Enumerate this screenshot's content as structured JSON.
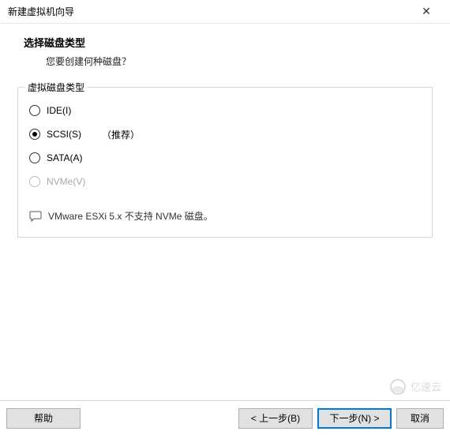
{
  "window": {
    "title": "新建虚拟机向导"
  },
  "header": {
    "heading": "选择磁盘类型",
    "subtitle": "您要创建何种磁盘？"
  },
  "fieldset": {
    "legend": "虚拟磁盘类型",
    "options": [
      {
        "label": "IDE(I)",
        "selected": false,
        "disabled": false,
        "recommended": ""
      },
      {
        "label": "SCSI(S)",
        "selected": true,
        "disabled": false,
        "recommended": "（推荐）"
      },
      {
        "label": "SATA(A)",
        "selected": false,
        "disabled": false,
        "recommended": ""
      },
      {
        "label": "NVMe(V)",
        "selected": false,
        "disabled": true,
        "recommended": ""
      }
    ],
    "info": "VMware ESXi 5.x 不支持 NVMe 磁盘。"
  },
  "footer": {
    "help": "帮助",
    "back": "< 上一步(B)",
    "next": "下一步(N) >",
    "cancel": "取消"
  },
  "watermark": "亿速云"
}
